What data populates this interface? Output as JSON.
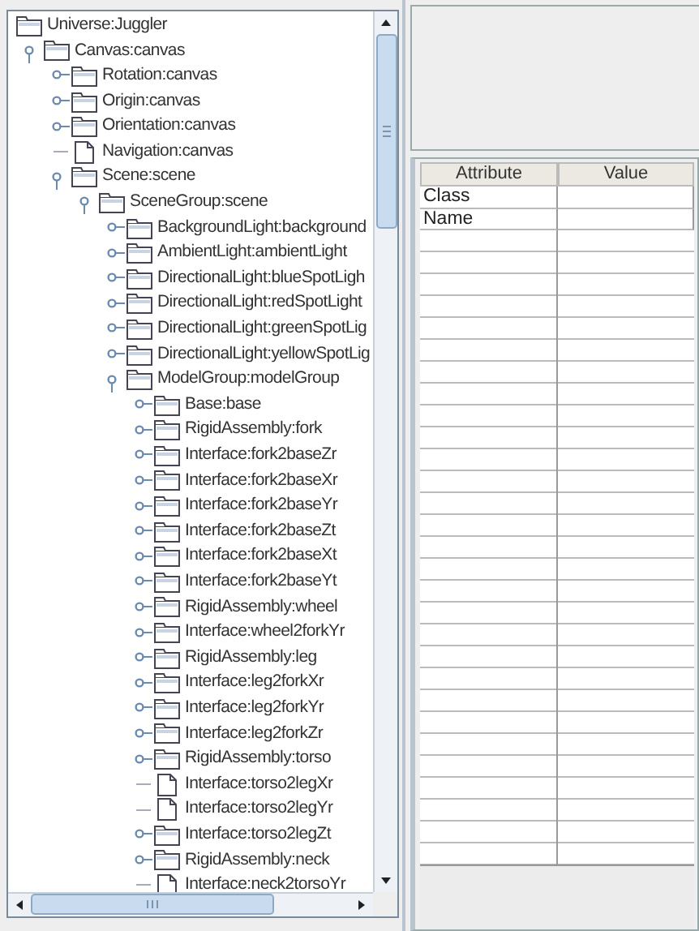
{
  "tree": {
    "label": "Universe:Juggler",
    "kind": "folder",
    "children": [
      {
        "label": "Canvas:canvas",
        "kind": "folder",
        "expanded": true,
        "children": [
          {
            "label": "Rotation:canvas",
            "kind": "folder",
            "expanded": false
          },
          {
            "label": "Origin:canvas",
            "kind": "folder",
            "expanded": false
          },
          {
            "label": "Orientation:canvas",
            "kind": "folder",
            "expanded": false
          },
          {
            "label": "Navigation:canvas",
            "kind": "file"
          },
          {
            "label": "Scene:scene",
            "kind": "folder",
            "expanded": true,
            "children": [
              {
                "label": "SceneGroup:scene",
                "kind": "folder",
                "expanded": true,
                "children": [
                  {
                    "label": "BackgroundLight:background",
                    "kind": "folder",
                    "expanded": false
                  },
                  {
                    "label": "AmbientLight:ambientLight",
                    "kind": "folder",
                    "expanded": false
                  },
                  {
                    "label": "DirectionalLight:blueSpotLigh",
                    "kind": "folder",
                    "expanded": false
                  },
                  {
                    "label": "DirectionalLight:redSpotLight",
                    "kind": "folder",
                    "expanded": false
                  },
                  {
                    "label": "DirectionalLight:greenSpotLig",
                    "kind": "folder",
                    "expanded": false
                  },
                  {
                    "label": "DirectionalLight:yellowSpotLig",
                    "kind": "folder",
                    "expanded": false
                  },
                  {
                    "label": "ModelGroup:modelGroup",
                    "kind": "folder",
                    "expanded": true,
                    "children": [
                      {
                        "label": "Base:base",
                        "kind": "folder",
                        "expanded": false
                      },
                      {
                        "label": "RigidAssembly:fork",
                        "kind": "folder",
                        "expanded": false
                      },
                      {
                        "label": "Interface:fork2baseZr",
                        "kind": "folder",
                        "expanded": false
                      },
                      {
                        "label": "Interface:fork2baseXr",
                        "kind": "folder",
                        "expanded": false
                      },
                      {
                        "label": "Interface:fork2baseYr",
                        "kind": "folder",
                        "expanded": false
                      },
                      {
                        "label": "Interface:fork2baseZt",
                        "kind": "folder",
                        "expanded": false
                      },
                      {
                        "label": "Interface:fork2baseXt",
                        "kind": "folder",
                        "expanded": false
                      },
                      {
                        "label": "Interface:fork2baseYt",
                        "kind": "folder",
                        "expanded": false
                      },
                      {
                        "label": "RigidAssembly:wheel",
                        "kind": "folder",
                        "expanded": false
                      },
                      {
                        "label": "Interface:wheel2forkYr",
                        "kind": "folder",
                        "expanded": false
                      },
                      {
                        "label": "RigidAssembly:leg",
                        "kind": "folder",
                        "expanded": false
                      },
                      {
                        "label": "Interface:leg2forkXr",
                        "kind": "folder",
                        "expanded": false
                      },
                      {
                        "label": "Interface:leg2forkYr",
                        "kind": "folder",
                        "expanded": false
                      },
                      {
                        "label": "Interface:leg2forkZr",
                        "kind": "folder",
                        "expanded": false
                      },
                      {
                        "label": "RigidAssembly:torso",
                        "kind": "folder",
                        "expanded": false
                      },
                      {
                        "label": "Interface:torso2legXr",
                        "kind": "file"
                      },
                      {
                        "label": "Interface:torso2legYr",
                        "kind": "file"
                      },
                      {
                        "label": "Interface:torso2legZt",
                        "kind": "folder",
                        "expanded": false
                      },
                      {
                        "label": "RigidAssembly:neck",
                        "kind": "folder",
                        "expanded": false
                      },
                      {
                        "label": "Interface:neck2torsoYr",
                        "kind": "file"
                      }
                    ]
                  }
                ]
              }
            ]
          }
        ]
      }
    ]
  },
  "table": {
    "columns": [
      "Attribute",
      "Value"
    ],
    "rows": [
      {
        "attribute": "Class"
      },
      {
        "attribute": "Name"
      }
    ]
  }
}
